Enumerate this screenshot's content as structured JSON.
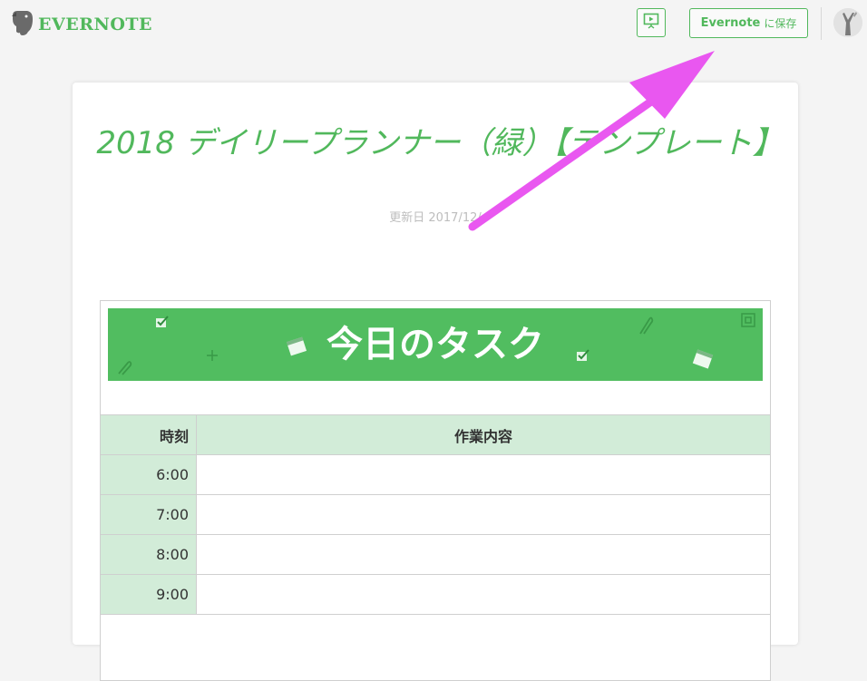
{
  "app": {
    "logo_text": "EVERNOTE"
  },
  "header": {
    "save_button_brand": "Evernote",
    "save_button_suffix": "に保存",
    "accent_color": "#51b85c"
  },
  "note": {
    "title": "2018 デイリープランナー（緑）【テンプレート】",
    "updated": "更新日 2017/12/"
  },
  "banner": {
    "title": "今日のタスク",
    "color": "#51bd60"
  },
  "table": {
    "headers": [
      "時刻",
      "作業内容"
    ],
    "rows": [
      {
        "time": "6:00",
        "task": ""
      },
      {
        "time": "7:00",
        "task": ""
      },
      {
        "time": "8:00",
        "task": ""
      },
      {
        "time": "9:00",
        "task": ""
      }
    ]
  },
  "annotation": {
    "arrow_color": "#e957f0"
  }
}
